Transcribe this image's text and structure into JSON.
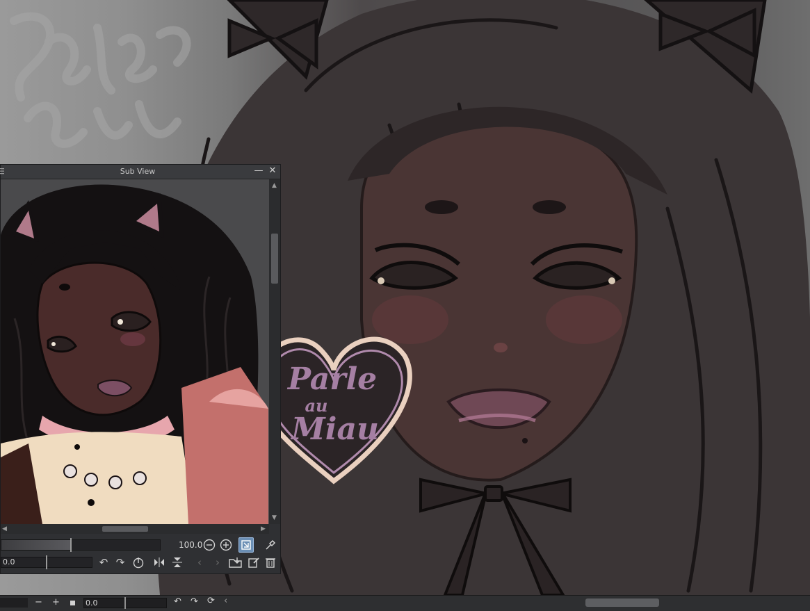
{
  "subview": {
    "title": "Sub View",
    "minimize_glyph": "—",
    "close_glyph": "✕",
    "zoom": {
      "value": "100.0",
      "slider_level": 0.44
    },
    "rotation": {
      "value": "0.0",
      "slider_level": 0.5
    },
    "icons": {
      "zoom_out": "zoom-out-icon",
      "zoom_in": "zoom-in-icon",
      "fit": "fit-to-window-icon",
      "eyedropper": "eyedropper-icon",
      "rotate_left": "rotate-left-icon",
      "rotate_right": "rotate-right-icon",
      "reset_rotation": "reset-rotation-icon",
      "flip_horizontal": "flip-horizontal-icon",
      "flip_vertical": "flip-vertical-icon",
      "previous": "previous-image-icon",
      "next": "next-image-icon",
      "import": "import-image-icon",
      "edit": "edit-image-icon",
      "delete": "trash-icon"
    }
  },
  "bottom_bar": {
    "rotation_value": "0.0",
    "minus_glyph": "−",
    "plus_glyph": "+"
  },
  "badge": {
    "text_line1": "Parle",
    "text_line2": "au",
    "text_line3": "Miau"
  },
  "colors": {
    "panel_bg": "#2f3033",
    "accent_active": "#6b8fb5",
    "badge_fill": "#a57fa3",
    "badge_border": "#e6c9b7"
  }
}
